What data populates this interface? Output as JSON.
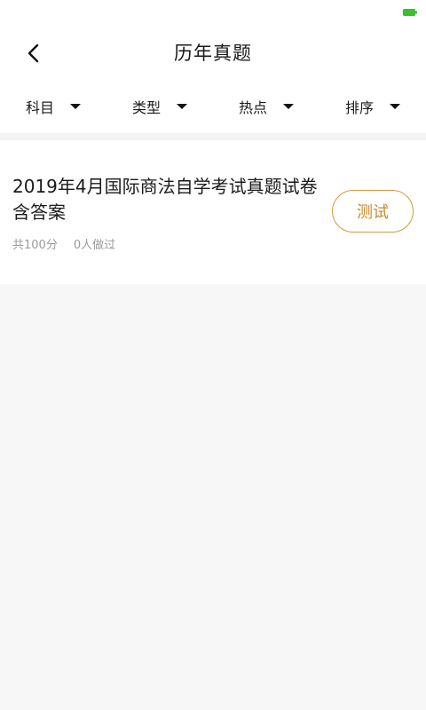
{
  "colors": {
    "accent": "#c58a2a",
    "accent_border": "#d29a3a",
    "background": "#f7f7f7",
    "battery": "#3bbf2e"
  },
  "status_bar": {
    "icons": [
      "battery-icon"
    ]
  },
  "header": {
    "title": "历年真题",
    "back_icon": "chevron-left-icon"
  },
  "filters": [
    {
      "label": "科目",
      "icon": "caret-down-icon"
    },
    {
      "label": "类型",
      "icon": "caret-down-icon"
    },
    {
      "label": "热点",
      "icon": "caret-down-icon"
    },
    {
      "label": "排序",
      "icon": "caret-down-icon"
    }
  ],
  "list": {
    "items": [
      {
        "title": "2019年4月国际商法自学考试真题试卷含答案",
        "score": "共100分",
        "participants": "0人做过",
        "action_label": "测试"
      }
    ]
  }
}
